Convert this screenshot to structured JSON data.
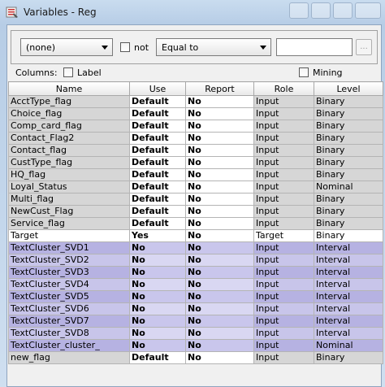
{
  "window": {
    "title": "Variables - Reg"
  },
  "filter": {
    "column_select": "(none)",
    "not_label": "not",
    "operator_select": "Equal to",
    "value_text": "",
    "ellipsis_label": "..."
  },
  "columns_bar": {
    "columns_label": "Columns:",
    "label_checkbox": "Label",
    "mining_checkbox": "Mining"
  },
  "table": {
    "headers": [
      "Name",
      "Use",
      "Report",
      "Role",
      "Level"
    ],
    "rows": [
      {
        "name": "AcctType_flag",
        "use": "Default",
        "report": "No",
        "role": "Input",
        "level": "Binary"
      },
      {
        "name": "Choice_flag",
        "use": "Default",
        "report": "No",
        "role": "Input",
        "level": "Binary"
      },
      {
        "name": "Comp_card_flag",
        "use": "Default",
        "report": "No",
        "role": "Input",
        "level": "Binary"
      },
      {
        "name": "Contact_Flag2",
        "use": "Default",
        "report": "No",
        "role": "Input",
        "level": "Binary"
      },
      {
        "name": "Contact_flag",
        "use": "Default",
        "report": "No",
        "role": "Input",
        "level": "Binary"
      },
      {
        "name": "CustType_flag",
        "use": "Default",
        "report": "No",
        "role": "Input",
        "level": "Binary"
      },
      {
        "name": "HQ_flag",
        "use": "Default",
        "report": "No",
        "role": "Input",
        "level": "Binary"
      },
      {
        "name": "Loyal_Status",
        "use": "Default",
        "report": "No",
        "role": "Input",
        "level": "Nominal"
      },
      {
        "name": "Multi_flag",
        "use": "Default",
        "report": "No",
        "role": "Input",
        "level": "Binary"
      },
      {
        "name": "NewCust_Flag",
        "use": "Default",
        "report": "No",
        "role": "Input",
        "level": "Binary"
      },
      {
        "name": "Service_flag",
        "use": "Default",
        "report": "No",
        "role": "Input",
        "level": "Binary"
      },
      {
        "name": "Target",
        "use": "Yes",
        "report": "No",
        "role": "Target",
        "level": "Binary"
      },
      {
        "name": "TextCluster_SVD1",
        "use": "No",
        "report": "No",
        "role": "Input",
        "level": "Interval"
      },
      {
        "name": "TextCluster_SVD2",
        "use": "No",
        "report": "No",
        "role": "Input",
        "level": "Interval"
      },
      {
        "name": "TextCluster_SVD3",
        "use": "No",
        "report": "No",
        "role": "Input",
        "level": "Interval"
      },
      {
        "name": "TextCluster_SVD4",
        "use": "No",
        "report": "No",
        "role": "Input",
        "level": "Interval"
      },
      {
        "name": "TextCluster_SVD5",
        "use": "No",
        "report": "No",
        "role": "Input",
        "level": "Interval"
      },
      {
        "name": "TextCluster_SVD6",
        "use": "No",
        "report": "No",
        "role": "Input",
        "level": "Interval"
      },
      {
        "name": "TextCluster_SVD7",
        "use": "No",
        "report": "No",
        "role": "Input",
        "level": "Interval"
      },
      {
        "name": "TextCluster_SVD8",
        "use": "No",
        "report": "No",
        "role": "Input",
        "level": "Interval"
      },
      {
        "name": "TextCluster_cluster_",
        "use": "No",
        "report": "No",
        "role": "Input",
        "level": "Nominal"
      },
      {
        "name": "new_flag",
        "use": "Default",
        "report": "No",
        "role": "Input",
        "level": "Binary"
      }
    ]
  }
}
